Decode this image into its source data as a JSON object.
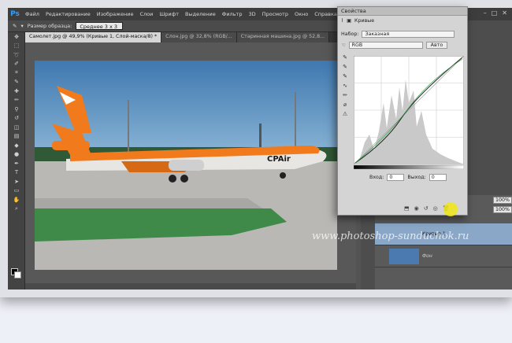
{
  "app": {
    "logo": "Ps"
  },
  "menu": [
    "Файл",
    "Редактирование",
    "Изображение",
    "Слои",
    "Шрифт",
    "Выделение",
    "Фильтр",
    "3D",
    "Просмотр",
    "Окно",
    "Справка"
  ],
  "options_bar": {
    "sample_label": "Размер образца:",
    "sample_value": "Среднее 3 х 3"
  },
  "tabs": [
    {
      "label": "Самолет.jpg @ 49,9% (Кривые 1, Слой-маска/8) *",
      "active": true
    },
    {
      "label": "Слон.jpg @ 32,8% (RGB/...",
      "active": false
    },
    {
      "label": "Старинная машина.jpg @ 52,8...",
      "active": false
    }
  ],
  "properties": {
    "panel_title": "Свойства",
    "adjustment_name": "Кривые",
    "preset_label": "Набор:",
    "preset_value": "Заказная",
    "channel_value": "RGB",
    "auto_label": "Авто",
    "input_label": "Вход:",
    "input_value": "0",
    "output_label": "Выход:",
    "output_value": "0"
  },
  "layers": {
    "opacity": "100%",
    "fill": "100%",
    "curves_layer": "Кривые 1",
    "background_layer": "Фон"
  },
  "photo": {
    "aircraft_text": "CPAir"
  },
  "watermark": "www.photoshop-sunduchok.ru",
  "colors": {
    "accent": "#2fa0ff",
    "cursor_highlight": "#f0e614",
    "aircraft_orange": "#f07a1c"
  }
}
